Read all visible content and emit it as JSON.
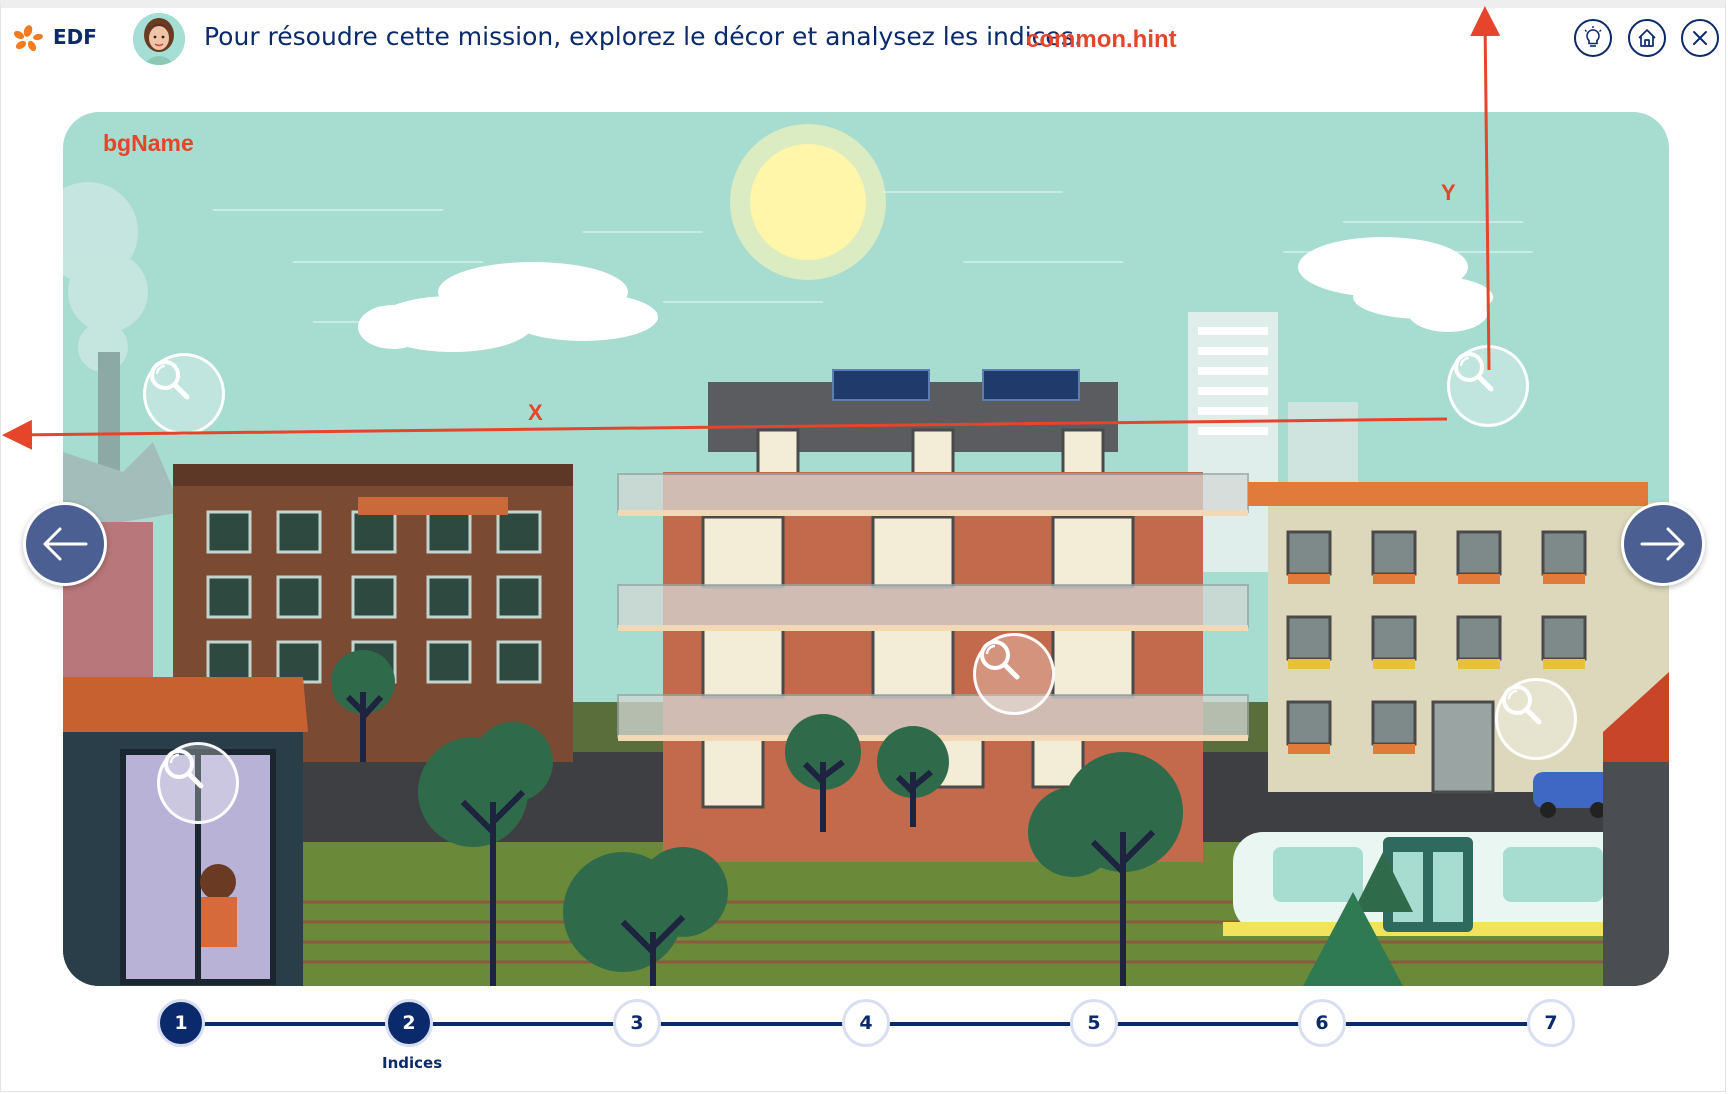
{
  "header": {
    "logo_text": "EDF",
    "instruction": "Pour résoudre cette mission, explorez le décor et analysez les indices.",
    "hint_key": "common.hint",
    "buttons": {
      "hint_icon": "lightbulb-icon",
      "home_icon": "home-icon",
      "close_icon": "close-icon"
    }
  },
  "scene": {
    "bg_name": "bgName",
    "axis_x": "X",
    "axis_y": "Y",
    "hotspot_icon": "magnifier-icon",
    "nav": {
      "prev_icon": "arrow-left-icon",
      "next_icon": "arrow-right-icon"
    }
  },
  "stepper": {
    "steps": [
      {
        "label": "1",
        "state": "done"
      },
      {
        "label": "2",
        "state": "current",
        "caption": "Indices"
      },
      {
        "label": "3",
        "state": "pending"
      },
      {
        "label": "4",
        "state": "pending"
      },
      {
        "label": "5",
        "state": "pending"
      },
      {
        "label": "6",
        "state": "pending"
      },
      {
        "label": "7",
        "state": "pending"
      }
    ]
  },
  "colors": {
    "brand_navy": "#0b2a6b",
    "annotation_red": "#e5452b",
    "nav_arrow": "#4b5f93",
    "sky": "#a7dcd1",
    "edf_orange": "#f47b20"
  }
}
